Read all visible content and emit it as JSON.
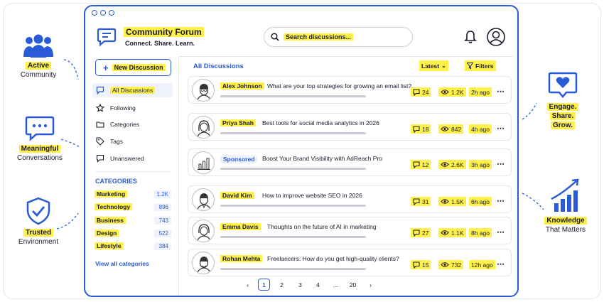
{
  "brand": {
    "title": "Community Forum",
    "tagline": "Connect. Share. Learn."
  },
  "search": {
    "placeholder": "Search discussions..."
  },
  "new_discussion": "New Discussion",
  "nav": [
    "All Discussions",
    "Following",
    "Categories",
    "Tags",
    "Unanswered"
  ],
  "categories_heading": "CATEGORIES",
  "categories": [
    {
      "name": "Marketing",
      "count": "1.2K"
    },
    {
      "name": "Technology",
      "count": "896"
    },
    {
      "name": "Business",
      "count": "743"
    },
    {
      "name": "Design",
      "count": "522"
    },
    {
      "name": "Lifestyle",
      "count": "384"
    }
  ],
  "view_all": "View all categories",
  "main": {
    "title": "All Discussions",
    "sort": "Latest",
    "filters": "Filters"
  },
  "posts": [
    {
      "author": "Alex Johnson",
      "title": "What are your top strategies for growing an email list?",
      "comments": "24",
      "views": "1.2K",
      "time": "2h ago"
    },
    {
      "author": "Priya Shah",
      "title": "Best tools for social media analytics in 2026",
      "comments": "18",
      "views": "842",
      "time": "4h ago"
    },
    {
      "author": "Sponsored",
      "title": "Boost Your Brand Visibility with AdReach Pro",
      "comments": "12",
      "views": "2.6K",
      "time": "3h ago"
    },
    {
      "author": "David Kim",
      "title": "How to improve website SEO in 2026",
      "comments": "31",
      "views": "1.5K",
      "time": "6h ago"
    },
    {
      "author": "Emma Davis",
      "title": "Thoughts on the future of AI in marketing",
      "comments": "27",
      "views": "1.1K",
      "time": "8h ago"
    },
    {
      "author": "Rohan Mehta",
      "title": "Freelancers: How do you get high-quality clients?",
      "comments": "15",
      "views": "732",
      "time": "12h ago"
    }
  ],
  "pagination": {
    "pages": [
      "1",
      "2",
      "3",
      "4",
      "...",
      "20"
    ],
    "current": "1"
  },
  "features": {
    "active": [
      "Active",
      "Community"
    ],
    "meaningful": [
      "Meaningful",
      "Conversations"
    ],
    "trusted": [
      "Trusted",
      "Environment"
    ],
    "engage": [
      "Engage.",
      "Share.",
      "Grow."
    ],
    "knowledge": [
      "Knowledge",
      "That Matters"
    ]
  },
  "colors": {
    "accent": "#2a5bd7",
    "highlight": "#fff04a"
  },
  "icons": {
    "brand": "chat-bubble-icon",
    "search": "search-icon",
    "bell": "bell-icon",
    "user": "user-icon",
    "comments": "comment-icon",
    "views": "eye-icon",
    "more": "more-icon"
  }
}
